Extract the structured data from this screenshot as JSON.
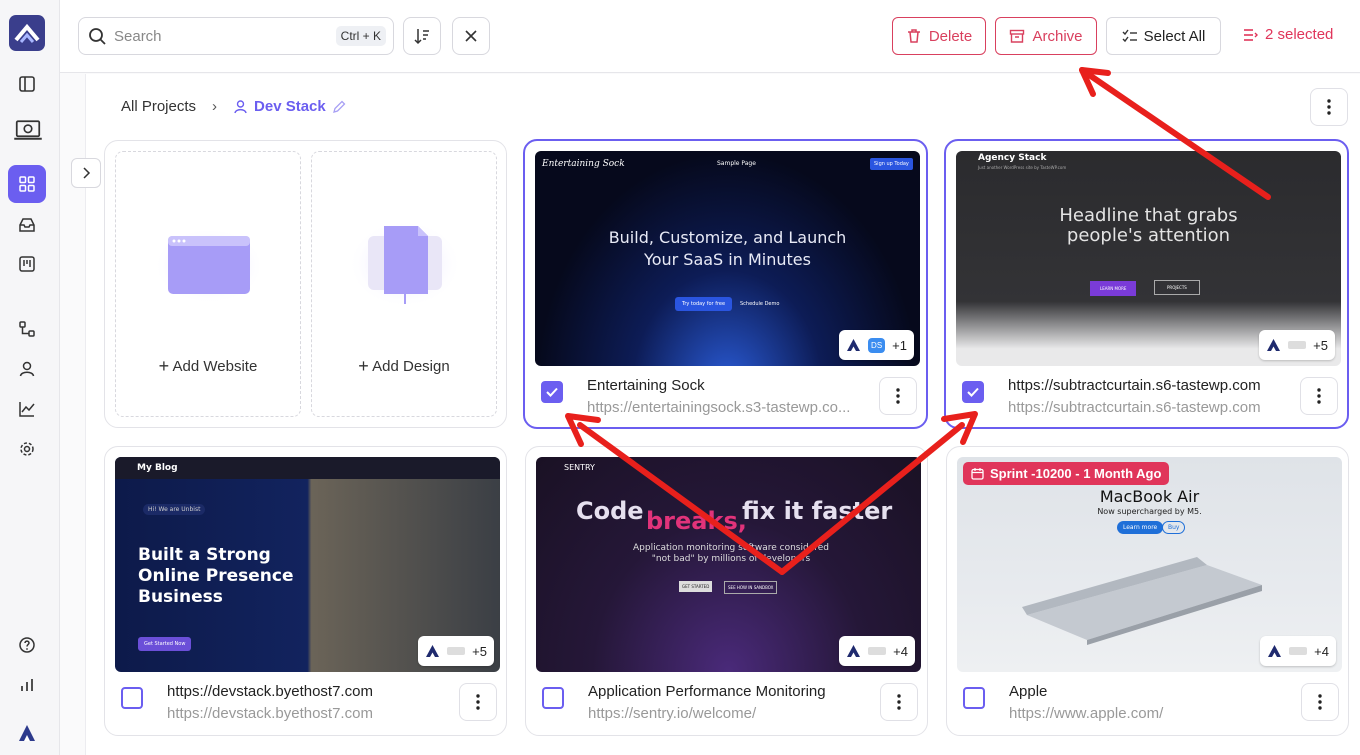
{
  "topbar": {
    "search_placeholder": "Search",
    "shortcut": "Ctrl + K",
    "delete_label": "Delete",
    "archive_label": "Archive",
    "select_all_label": "Select All",
    "selected_label": "2 selected"
  },
  "breadcrumb": {
    "root": "All Projects",
    "current": "Dev Stack"
  },
  "add": {
    "website": "Add Website",
    "design": "Add Design"
  },
  "cards": [
    {
      "title": "Entertaining Sock",
      "url": "https://entertainingsock.s3-tastewp.co...",
      "selected": true,
      "badge": "+1",
      "thumb": {
        "brand": "Entertaining Sock",
        "nav": "Sample Page",
        "cta": "Sign up Today",
        "headline": "Build, Customize, and Launch Your SaaS in Minutes",
        "btn1": "Try today for free",
        "btn2": "Schedule Demo"
      }
    },
    {
      "title": "https://subtractcurtain.s6-tastewp.com",
      "url": "https://subtractcurtain.s6-tastewp.com",
      "selected": true,
      "badge": "+5",
      "thumb": {
        "brand": "Agency Stack",
        "tag": "Just another WordPress site by TasteWP.com",
        "headline": "Headline that grabs people's attention",
        "btn1": "LEARN MORE",
        "btn2": "PROJECTS"
      }
    },
    {
      "title": "https://devstack.byethost7.com",
      "url": "https://devstack.byethost7.com",
      "selected": false,
      "badge": "+5",
      "thumb": {
        "brand": "My Blog",
        "greet": "Hi! We are Unbist",
        "headline": "Built a Strong Online Presence Business",
        "btn1": "Get Started Now"
      }
    },
    {
      "title": "Application Performance Monitoring",
      "url": "https://sentry.io/welcome/",
      "selected": false,
      "badge": "+4",
      "thumb": {
        "brand": "SENTRY",
        "headline1": "Code",
        "headline2": "breaks,",
        "headline3": "fix it faster",
        "sub": "Application monitoring software considered \"not bad\" by millions of developers",
        "btn1": "GET STARTED",
        "btn2": "SEE HOW IN SANDBOX"
      }
    },
    {
      "title": "Apple",
      "url": "https://www.apple.com/",
      "selected": false,
      "badge": "+4",
      "thumb": {
        "sprint": "Sprint -10200 - 1 Month Ago",
        "headline": "MacBook Air",
        "sub": "Now supercharged by M5.",
        "btn1": "Learn more",
        "btn2": "Buy"
      }
    }
  ],
  "colors": {
    "accent": "#6b5ef0",
    "danger": "#d9405e",
    "arrow": "#e8201c"
  }
}
